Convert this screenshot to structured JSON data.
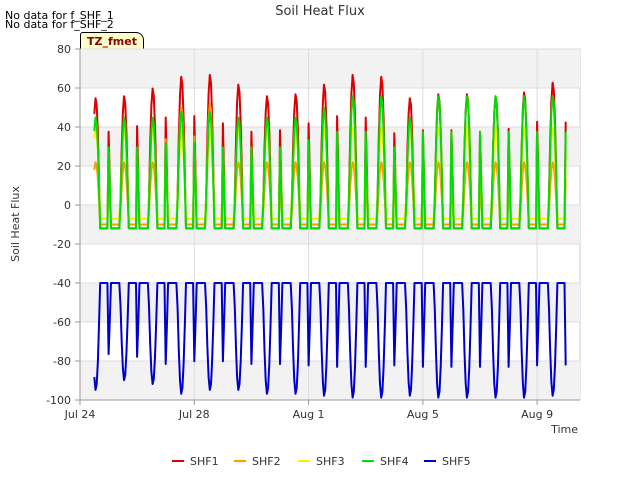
{
  "notes": [
    "No data for f_SHF_1",
    "No data for f_SHF_2"
  ],
  "tz_label": "TZ_fmet",
  "chart_data": {
    "type": "line",
    "title": "Soil Heat Flux",
    "xlabel": "Time",
    "ylabel": "Soil Heat Flux",
    "ylim": [
      -100,
      80
    ],
    "yticks": [
      -100,
      -80,
      -60,
      -40,
      -20,
      0,
      20,
      40,
      60,
      80
    ],
    "xlim": [
      "2023-07-24",
      "2023-08-10 12:00"
    ],
    "xticks": [
      {
        "date": "2023-07-24",
        "label": "Jul 24"
      },
      {
        "date": "2023-07-28",
        "label": "Jul 28"
      },
      {
        "date": "2023-08-01",
        "label": "Aug 1"
      },
      {
        "date": "2023-08-05",
        "label": "Aug 5"
      },
      {
        "date": "2023-08-09",
        "label": "Aug 9"
      }
    ],
    "grid": true,
    "legend_position": "bottom",
    "start_date": "2023-07-24 12:00",
    "end_date": "2023-08-10 00:00",
    "series": [
      {
        "name": "SHF1",
        "color": "#dd0000",
        "base": -12,
        "daily_peaks": [
          55,
          56,
          60,
          66,
          67,
          62,
          56,
          57,
          62,
          67,
          66,
          55,
          57,
          57,
          56,
          58,
          63
        ]
      },
      {
        "name": "SHF2",
        "color": "#ff9900",
        "base": -10,
        "daily_peaks": [
          22,
          22,
          22,
          50,
          52,
          22,
          22,
          22,
          22,
          22,
          22,
          22,
          22,
          22,
          22,
          22,
          22
        ]
      },
      {
        "name": "SHF3",
        "color": "#ffee00",
        "base": -7,
        "daily_peaks": [
          40,
          40,
          40,
          38,
          38,
          40,
          40,
          40,
          40,
          40,
          40,
          40,
          40,
          40,
          40,
          40,
          40
        ]
      },
      {
        "name": "SHF4",
        "color": "#00dd00",
        "base": -12,
        "daily_peaks": [
          45,
          45,
          45,
          48,
          48,
          45,
          45,
          45,
          50,
          56,
          56,
          45,
          56,
          56,
          56,
          56,
          56
        ]
      },
      {
        "name": "SHF5",
        "color": "#0000cc",
        "base": -40,
        "daily_troughs": [
          -95,
          -90,
          -92,
          -97,
          -95,
          -95,
          -97,
          -97,
          -98,
          -99,
          -99,
          -98,
          -99,
          -99,
          -99,
          -99,
          -98
        ]
      }
    ]
  }
}
